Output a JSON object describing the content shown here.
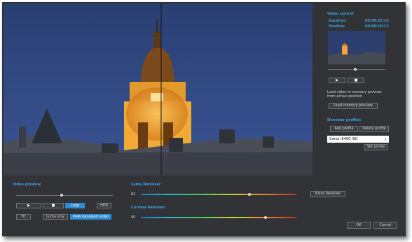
{
  "video_control": {
    "title": "Video control",
    "duration_label": "Duration",
    "duration_value": "00:00:22:16",
    "position_label": "Position",
    "position_value": "00:00:10:12",
    "mini_slider_fraction": 0.47,
    "load_info": "Load video to memory preview from actual position",
    "load_button": "Load memory preview"
  },
  "denoiser_profiles": {
    "title": "Denoiser profiles",
    "add_button": "Add profile",
    "delete_button": "Delete profile",
    "selected_profile": "Canon 6400 ISO",
    "set_button": "Set profile"
  },
  "video_preview": {
    "title": "Video preview",
    "slider_fraction": 0.47,
    "loop_button": "Loop",
    "hdr_button": "HDR",
    "fit_button": "Fit",
    "luma_only_button": "Luma only",
    "view_denoised_button": "View denoised video"
  },
  "luma_denoiser": {
    "title": "Luma Denoiser",
    "value": "82",
    "slider_fraction": 0.7
  },
  "chroma_denoiser": {
    "title": "Chroma Denoiser",
    "value": "90",
    "slider_fraction": 0.8
  },
  "extra_denoiser_button": "Extra denoiser",
  "ok_button": "OK",
  "cancel_button": "Cancel",
  "colors": {
    "accent": "#2f8bd4",
    "window_bg": "#313336",
    "heading": "#3aa0e8"
  }
}
